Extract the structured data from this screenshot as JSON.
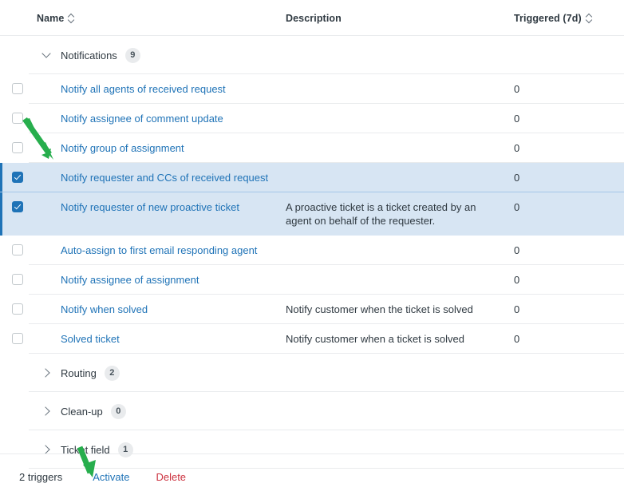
{
  "table": {
    "columns": [
      {
        "key": "name",
        "label": "Name",
        "sortable": true,
        "sort_icon": "sort-updown-icon"
      },
      {
        "key": "description",
        "label": "Description",
        "sortable": false
      },
      {
        "key": "triggered",
        "label": "Triggered (7d)",
        "sortable": true,
        "sort_icon": "sort-updown-icon"
      }
    ],
    "groups": [
      {
        "name": "Notifications",
        "count": "9",
        "expanded": true,
        "chevron": "chevron-down-icon",
        "rows": [
          {
            "checked": false,
            "name": "Notify all agents of received request",
            "description": "",
            "triggered": "0"
          },
          {
            "checked": false,
            "name": "Notify assignee of comment update",
            "description": "",
            "triggered": "0"
          },
          {
            "checked": false,
            "name": "Notify group of assignment",
            "description": "",
            "triggered": "0"
          },
          {
            "checked": true,
            "name": "Notify requester and CCs of received request",
            "description": "",
            "triggered": "0"
          },
          {
            "checked": true,
            "name": "Notify requester of new proactive ticket",
            "description": "A proactive ticket is a ticket created by an agent on behalf of the requester.",
            "triggered": "0"
          },
          {
            "checked": false,
            "name": "Auto-assign to first email responding agent",
            "description": "",
            "triggered": "0"
          },
          {
            "checked": false,
            "name": "Notify assignee of assignment",
            "description": "",
            "triggered": "0"
          },
          {
            "checked": false,
            "name": "Notify when solved",
            "description": "Notify customer when the ticket is solved",
            "triggered": "0"
          },
          {
            "checked": false,
            "name": "Solved ticket",
            "description": "Notify customer when a ticket is solved",
            "triggered": "0"
          }
        ]
      },
      {
        "name": "Routing",
        "count": "2",
        "expanded": false,
        "chevron": "chevron-right-icon",
        "rows": []
      },
      {
        "name": "Clean-up",
        "count": "0",
        "expanded": false,
        "chevron": "chevron-right-icon",
        "rows": []
      },
      {
        "name": "Ticket field",
        "count": "1",
        "expanded": false,
        "chevron": "chevron-right-icon",
        "rows": []
      }
    ]
  },
  "footer": {
    "selection_count": "2 triggers",
    "activate_label": "Activate",
    "delete_label": "Delete"
  },
  "colors": {
    "link": "#1f73b7",
    "delete": "#cc3340",
    "selected_row_bg": "#d7e5f3",
    "selected_accent": "#1f73b7",
    "annotation_arrow": "#27ae4d",
    "divider": "#e9ebed",
    "text": "#2f3941"
  },
  "annotations": [
    {
      "name": "arrow-to-selected-checkbox",
      "shape": "arrow-down-right-icon",
      "color": "#27ae4d"
    },
    {
      "name": "arrow-to-activate-button",
      "shape": "arrow-down-icon",
      "color": "#27ae4d"
    }
  ]
}
